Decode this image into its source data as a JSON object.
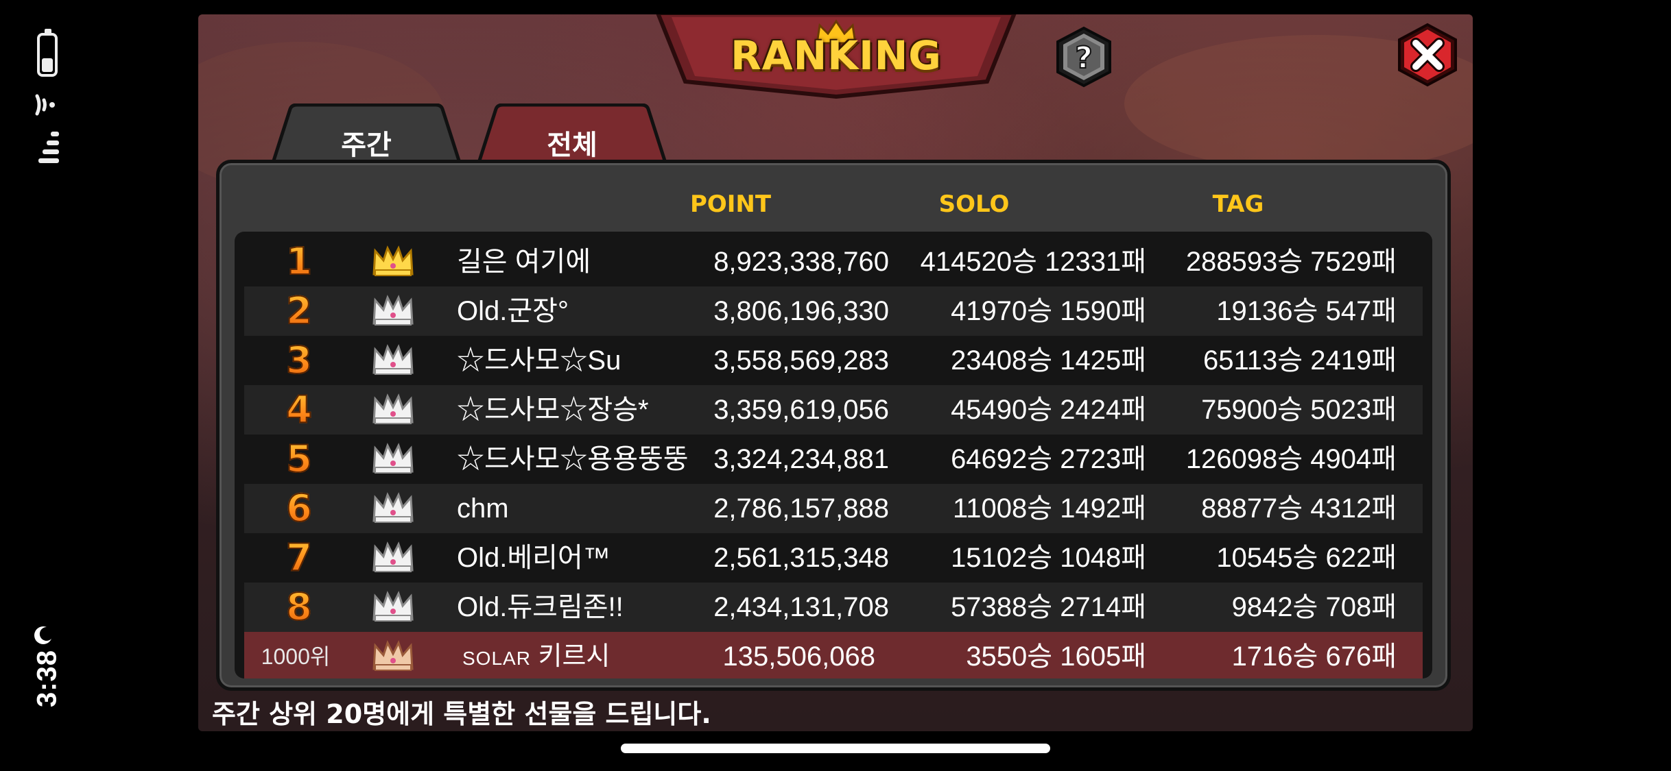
{
  "status_bar": {
    "time": "3:38",
    "battery_level": 0.35,
    "icons": [
      "battery-icon",
      "wifi-icon",
      "cellular-signal-icon",
      "moon-icon"
    ]
  },
  "header": {
    "title": "RANKING",
    "help_icon": "question-mark-icon",
    "close_icon": "close-x-icon"
  },
  "tabs": [
    {
      "label": "주간",
      "active": true
    },
    {
      "label": "전체",
      "active": false
    }
  ],
  "columns": {
    "point": "POINT",
    "solo": "SOLO",
    "tag": "TAG"
  },
  "rows": [
    {
      "rank": "1",
      "crown": "gold",
      "name": "길은 여기에",
      "point": "8,923,338,760",
      "solo": "414520승 12331패",
      "tag": "288593승 7529패"
    },
    {
      "rank": "2",
      "crown": "silver",
      "name": "Old.군장°",
      "point": "3,806,196,330",
      "solo": "41970승 1590패",
      "tag": "19136승 547패"
    },
    {
      "rank": "3",
      "crown": "silver",
      "name": "☆드사모☆Su",
      "point": "3,558,569,283",
      "solo": "23408승 1425패",
      "tag": "65113승 2419패"
    },
    {
      "rank": "4",
      "crown": "silver",
      "name": "☆드사모☆장승*",
      "point": "3,359,619,056",
      "solo": "45490승 2424패",
      "tag": "75900승 5023패"
    },
    {
      "rank": "5",
      "crown": "silver",
      "name": "☆드사모☆용용뚱뚱",
      "point": "3,324,234,881",
      "solo": "64692승 2723패",
      "tag": "126098승 4904패"
    },
    {
      "rank": "6",
      "crown": "silver",
      "name": "chm",
      "point": "2,786,157,888",
      "solo": "11008승 1492패",
      "tag": "88877승 4312패"
    },
    {
      "rank": "7",
      "crown": "silver",
      "name": "Old.베리어™",
      "point": "2,561,315,348",
      "solo": "15102승 1048패",
      "tag": "10545승 622패"
    },
    {
      "rank": "8",
      "crown": "silver",
      "name": "Old.듀크림존!!",
      "point": "2,434,131,708",
      "solo": "57388승 2714패",
      "tag": "9842승 708패"
    }
  ],
  "my_row": {
    "rank": "1000위",
    "crown": "bronze",
    "guild": "SOLAR",
    "name": "키르시",
    "point": "135,506,068",
    "solo": "3550승 1605패",
    "tag": "1716승 676패"
  },
  "footer": {
    "note": "주간 상위 20명에게 특별한 선물을 드립니다."
  },
  "colors": {
    "accent_gold": "#ffc61a",
    "tab_active": "#3a3a3a",
    "tab_inactive": "#7a2a2e",
    "my_row_bg": "#6e2b2e",
    "close_red": "#d9262c"
  }
}
